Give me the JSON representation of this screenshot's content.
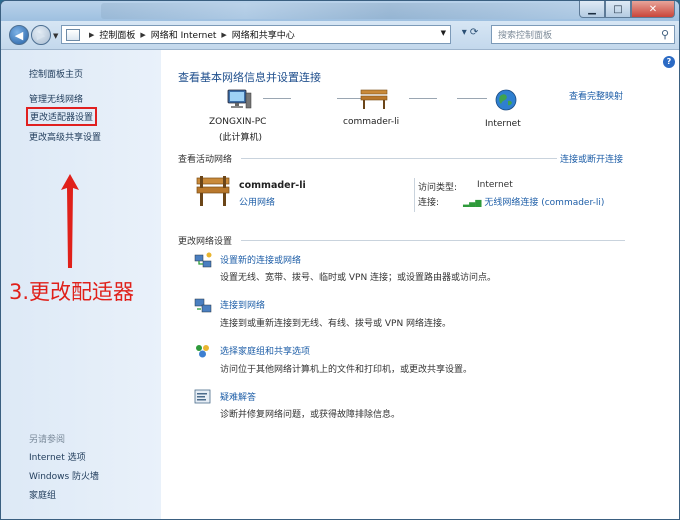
{
  "window": {
    "minimize_icon": "minimize-icon",
    "maximize_icon": "maximize-icon",
    "close_icon": "close-icon"
  },
  "nav": {
    "breadcrumbs": [
      "控制面板",
      "网络和 Internet",
      "网络和共享中心"
    ],
    "search_placeholder": "搜索控制面板"
  },
  "sidebar": {
    "items": [
      {
        "label": "控制面板主页"
      },
      {
        "label": "管理无线网络"
      },
      {
        "label": "更改适配器设置"
      },
      {
        "label": "更改高级共享设置"
      }
    ],
    "see_also_label": "另请参阅",
    "see_also": [
      {
        "label": "Internet 选项"
      },
      {
        "label": "Windows 防火墙"
      },
      {
        "label": "家庭组"
      }
    ]
  },
  "main": {
    "title": "查看基本网络信息并设置连接",
    "full_map_link": "查看完整映射",
    "map": {
      "pc_name": "ZONGXIN-PC",
      "pc_sub": "(此计算机)",
      "network": "commader-li",
      "internet": "Internet"
    },
    "active": {
      "section": "查看活动网络",
      "connect_link": "连接或断开连接",
      "name": "commader-li",
      "type": "公用网络",
      "access_label": "访问类型:",
      "access_value": "Internet",
      "conn_label": "连接:",
      "conn_value": "无线网络连接 (commader-li)"
    },
    "settings": {
      "section": "更改网络设置",
      "tasks": [
        {
          "title": "设置新的连接或网络",
          "desc": "设置无线、宽带、拨号、临时或 VPN 连接；或设置路由器或访问点。"
        },
        {
          "title": "连接到网络",
          "desc": "连接到或重新连接到无线、有线、拨号或 VPN 网络连接。"
        },
        {
          "title": "选择家庭组和共享选项",
          "desc": "访问位于其他网络计算机上的文件和打印机，或更改共享设置。"
        },
        {
          "title": "疑难解答",
          "desc": "诊断并修复网络问题，或获得故障排除信息。"
        }
      ]
    }
  },
  "annotation": {
    "text": "3.更改配适器",
    "color": "#e0201a"
  }
}
